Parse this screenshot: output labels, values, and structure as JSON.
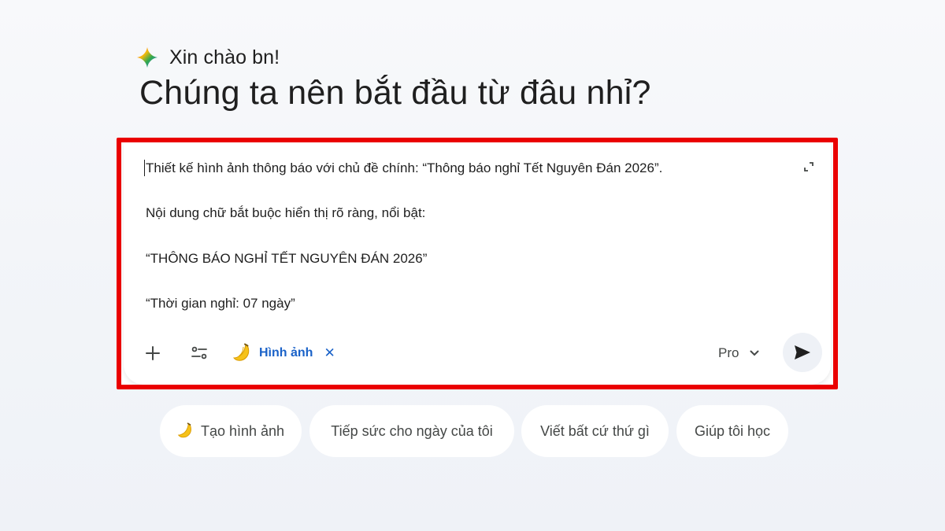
{
  "greeting": {
    "icon": "gemini-spark-icon",
    "text": "Xin chào bn!"
  },
  "headline": "Chúng ta nên bắt đầu từ đâu nhỉ?",
  "prompt": {
    "lines": [
      "Thiết kế hình ảnh thông báo với chủ đề chính: “Thông báo nghỉ Tết Nguyên Đán 2026”.",
      "Nội dung chữ bắt buộc hiển thị rõ ràng, nổi bật:",
      "“THÔNG BÁO NGHỈ TẾT NGUYÊN ĐÁN 2026”",
      "“Thời gian nghỉ: 07 ngày”"
    ],
    "expand_icon": "expand-icon"
  },
  "toolbar": {
    "add_icon": "plus-icon",
    "tools_icon": "tools-sliders-icon",
    "image_chip": {
      "icon": "banana-icon",
      "label": "Hình ảnh",
      "remove": "✕"
    },
    "model": {
      "label": "Pro",
      "icon": "chevron-down-icon"
    },
    "send_icon": "send-icon"
  },
  "suggestions": [
    {
      "label": "Tạo hình ảnh",
      "icon": "banana-icon"
    },
    {
      "label": "Tiếp sức cho ngày của tôi"
    },
    {
      "label": "Viết bất cứ thứ gì"
    },
    {
      "label": "Giúp tôi học"
    }
  ],
  "colors": {
    "highlight_border": "#ea0000",
    "chip_text": "#1a62c8",
    "page_background": "#f3f5f9"
  }
}
